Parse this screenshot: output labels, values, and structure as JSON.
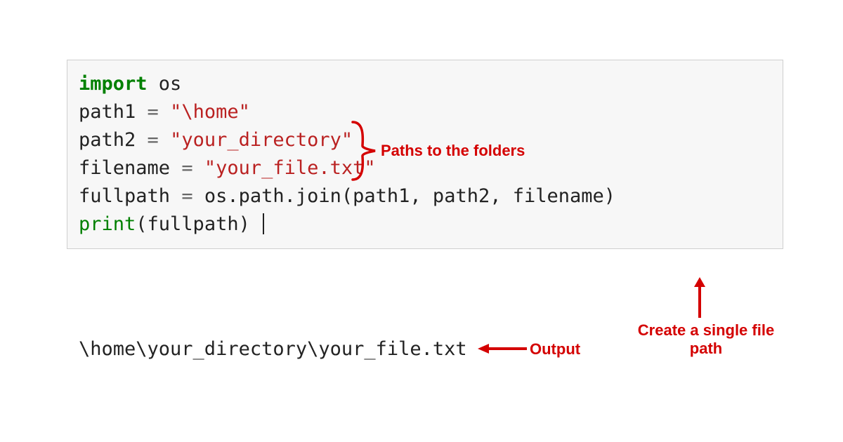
{
  "code": {
    "l1_kw": "import",
    "l1_mod": " os",
    "blank1": "",
    "l3_var": "path1 ",
    "l3_op": "= ",
    "l3_str": "\"\\home\"",
    "l4_var": "path2 ",
    "l4_op": "= ",
    "l4_str": "\"your_directory\"",
    "l5_var": "filename ",
    "l5_op": "= ",
    "l5_str": "\"your_file.txt\"",
    "blank2": "",
    "l7_var": "fullpath ",
    "l7_op": "= ",
    "l7_rest": "os.path.join(path1, path2, filename)",
    "l8_fn": "print",
    "l8_args": "(fullpath)"
  },
  "output": "\\home\\your_directory\\your_file.txt",
  "annotations": {
    "paths": "Paths to the folders",
    "create": "Create a single file\npath",
    "output": "Output"
  }
}
